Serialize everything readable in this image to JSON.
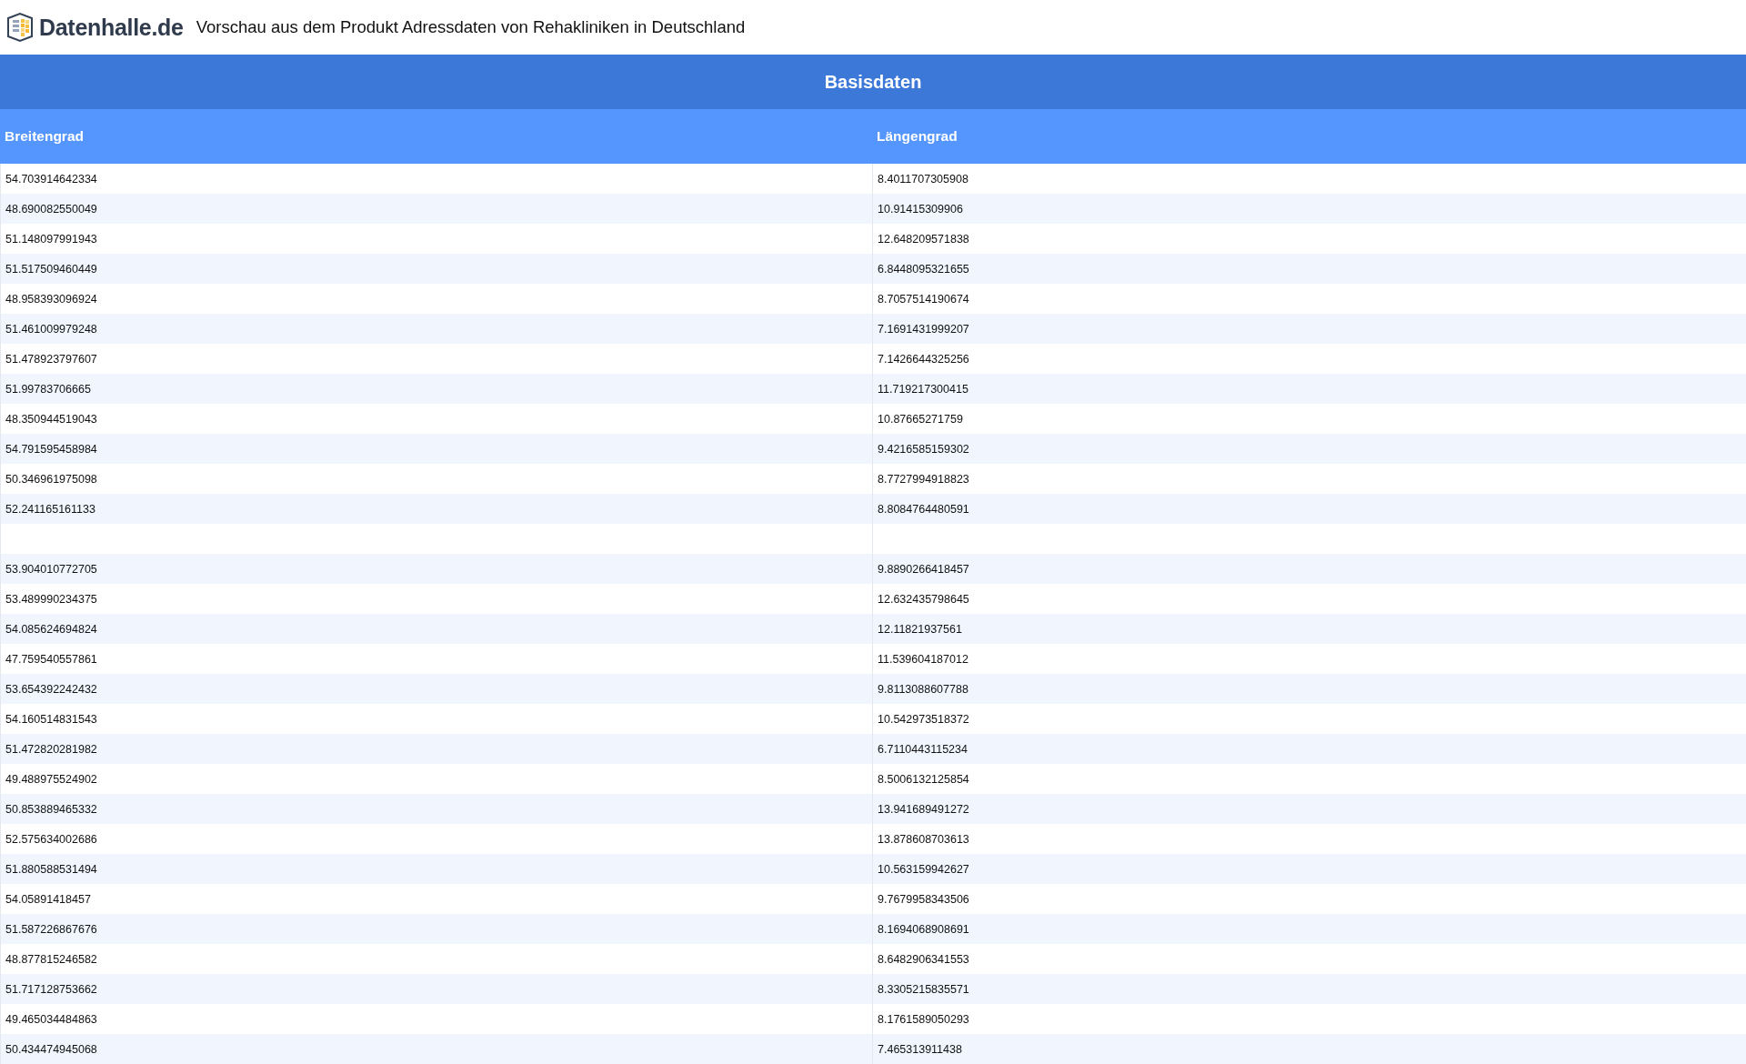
{
  "header": {
    "logo_text": "Datenhalle.de",
    "title": "Vorschau aus dem Produkt Adressdaten von Rehakliniken in Deutschland"
  },
  "table": {
    "caption": "Basisdaten",
    "columns": [
      "Breitengrad",
      "Längengrad"
    ],
    "rows": [
      [
        "54.703914642334",
        "8.4011707305908"
      ],
      [
        "48.690082550049",
        "10.91415309906"
      ],
      [
        "51.148097991943",
        "12.648209571838"
      ],
      [
        "51.517509460449",
        "6.8448095321655"
      ],
      [
        "48.958393096924",
        "8.7057514190674"
      ],
      [
        "51.461009979248",
        "7.1691431999207"
      ],
      [
        "51.478923797607",
        "7.1426644325256"
      ],
      [
        "51.99783706665",
        "11.719217300415"
      ],
      [
        "48.350944519043",
        "10.87665271759"
      ],
      [
        "54.791595458984",
        "9.4216585159302"
      ],
      [
        "50.346961975098",
        "8.7727994918823"
      ],
      [
        "52.241165161133",
        "8.8084764480591"
      ],
      [],
      [
        "53.904010772705",
        "9.8890266418457"
      ],
      [
        "53.489990234375",
        "12.632435798645"
      ],
      [
        "54.085624694824",
        "12.11821937561"
      ],
      [
        "47.759540557861",
        "11.539604187012"
      ],
      [
        "53.654392242432",
        "9.8113088607788"
      ],
      [
        "54.160514831543",
        "10.542973518372"
      ],
      [
        "51.472820281982",
        "6.7110443115234"
      ],
      [
        "49.488975524902",
        "8.5006132125854"
      ],
      [
        "50.853889465332",
        "13.941689491272"
      ],
      [
        "52.575634002686",
        "13.878608703613"
      ],
      [
        "51.880588531494",
        "10.563159942627"
      ],
      [
        "54.05891418457",
        "9.7679958343506"
      ],
      [
        "51.587226867676",
        "8.1694068908691"
      ],
      [
        "48.877815246582",
        "8.6482906341553"
      ],
      [
        "51.717128753662",
        "8.3305215835571"
      ],
      [
        "49.465034484863",
        "8.1761589050293"
      ],
      [
        "50.434474945068",
        "7.465313911438"
      ]
    ]
  }
}
